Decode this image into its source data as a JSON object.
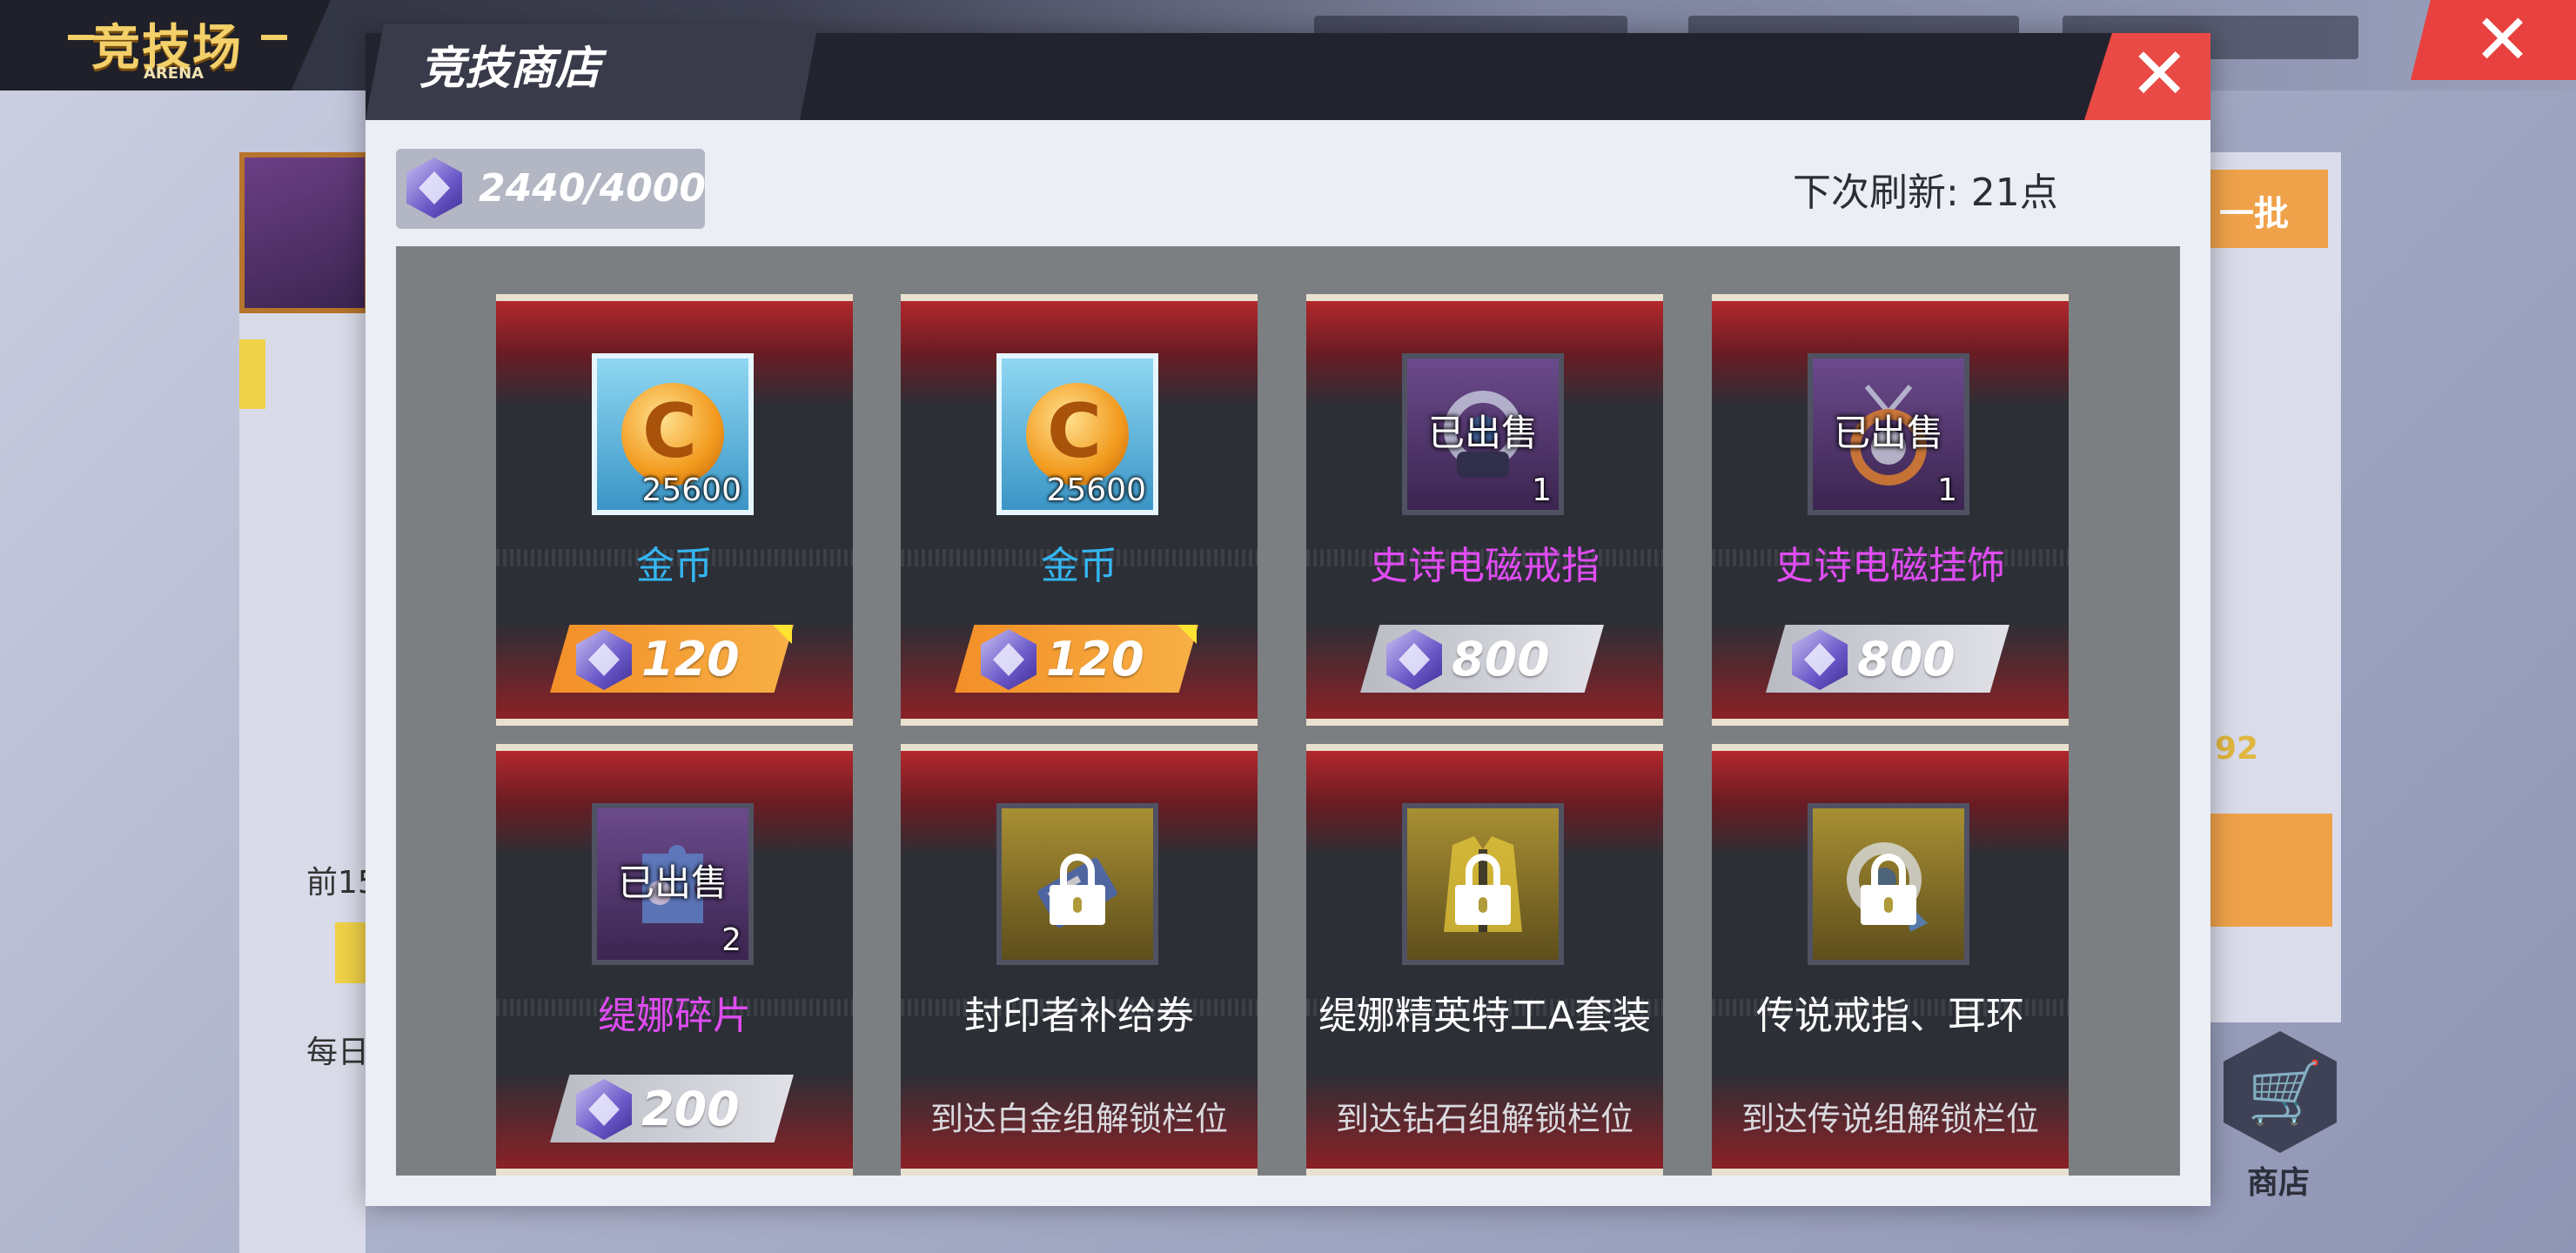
{
  "background": {
    "arena_title": "竞技场",
    "arena_subtitle": "ARENA",
    "bg_close_icon": "✕",
    "left_text_1": "前15",
    "left_text_2": "每日",
    "right_button_label": "一批",
    "right_value": "92",
    "shop_button_label": "商店",
    "shop_icon": "cart-icon"
  },
  "modal": {
    "title": "竞技商店",
    "close_icon": "✕",
    "currency": {
      "value": "2440/4000",
      "icon": "arena-token-icon"
    },
    "refresh_text": "下次刷新: 21点"
  },
  "colors": {
    "accent_red": "#ea4a45",
    "orange_price": "#f38f28",
    "blue_name": "#34b6f2",
    "purple_name": "#e04cf2"
  },
  "items": [
    {
      "name": "金币",
      "quantity": "25600",
      "price": "120",
      "status": "available",
      "rarity": "blue",
      "icon": "gold-coin-icon"
    },
    {
      "name": "金币",
      "quantity": "25600",
      "price": "120",
      "status": "available",
      "rarity": "blue",
      "icon": "gold-coin-icon"
    },
    {
      "name": "史诗电磁戒指",
      "quantity": "1",
      "price": "800",
      "status": "sold",
      "sold_label": "已出售",
      "rarity": "purple",
      "icon": "ring-icon"
    },
    {
      "name": "史诗电磁挂饰",
      "quantity": "1",
      "price": "800",
      "status": "sold",
      "sold_label": "已出售",
      "rarity": "purple",
      "icon": "pendant-icon"
    },
    {
      "name": "缇娜碎片",
      "quantity": "2",
      "price": "200",
      "status": "sold",
      "sold_label": "已出售",
      "rarity": "purple",
      "icon": "puzzle-shard-icon"
    },
    {
      "name": "封印者补给券",
      "status": "locked",
      "unlock_text": "到达白金组解锁栏位",
      "icon": "lock-icon"
    },
    {
      "name": "缇娜精英特工A套装",
      "status": "locked",
      "unlock_text": "到达钻石组解锁栏位",
      "icon": "lock-icon"
    },
    {
      "name": "传说戒指、耳环",
      "status": "locked",
      "unlock_text": "到达传说组解锁栏位",
      "icon": "lock-icon"
    }
  ]
}
